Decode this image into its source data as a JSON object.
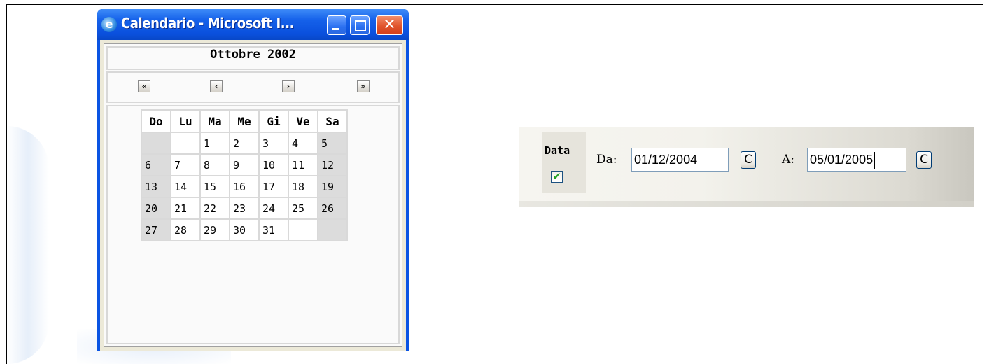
{
  "window": {
    "title": "Calendario - Microsoft I...",
    "icon": "ie-icon",
    "minimize_icon": "minimize-icon",
    "maximize_icon": "maximize-icon",
    "close_label": "✕"
  },
  "calendar": {
    "month_year": "Ottobre 2002",
    "nav": {
      "first": "«",
      "prev": "‹",
      "next": "›",
      "last": "»"
    },
    "weekdays": [
      "Do",
      "Lu",
      "Ma",
      "Me",
      "Gi",
      "Ve",
      "Sa"
    ],
    "weeks": [
      [
        "",
        "",
        "1",
        "2",
        "3",
        "4",
        "5"
      ],
      [
        "6",
        "7",
        "8",
        "9",
        "10",
        "11",
        "12"
      ],
      [
        "13",
        "14",
        "15",
        "16",
        "17",
        "18",
        "19"
      ],
      [
        "20",
        "21",
        "22",
        "23",
        "24",
        "25",
        "26"
      ],
      [
        "27",
        "28",
        "29",
        "30",
        "31",
        "",
        ""
      ]
    ]
  },
  "filter": {
    "data_label": "Data",
    "data_checked": true,
    "check_mark": "✔",
    "from_label": "Da:",
    "from_value": "01/12/2004",
    "from_button": "C",
    "to_label": "A:",
    "to_value": "05/01/2005",
    "to_button": "C"
  },
  "colors": {
    "titlebar": "#0a54e3",
    "close": "#e0542c",
    "check": "#21a121"
  }
}
